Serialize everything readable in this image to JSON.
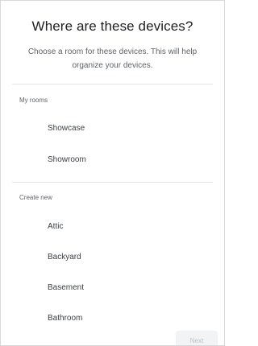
{
  "header": {
    "title": "Where are these devices?",
    "subtitle": "Choose a room for these devices. This will help organize your devices."
  },
  "sections": {
    "my_rooms": {
      "label": "My rooms",
      "items": [
        "Showcase",
        "Showroom"
      ]
    },
    "create_new": {
      "label": "Create new",
      "items": [
        "Attic",
        "Backyard",
        "Basement",
        "Bathroom"
      ]
    }
  },
  "footer": {
    "next_label": "Next"
  }
}
